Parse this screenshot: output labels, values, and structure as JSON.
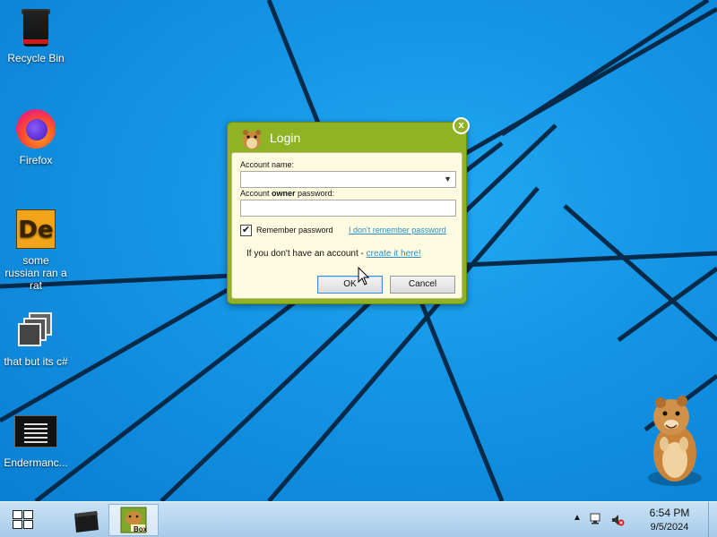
{
  "desktop": {
    "icons": [
      {
        "label": "Recycle Bin",
        "icon": "recycle-bin-icon"
      },
      {
        "label": "Firefox",
        "icon": "firefox-icon"
      },
      {
        "label": "some russian ran a rat",
        "icon": "de-app-icon"
      },
      {
        "label": "that but its c#",
        "icon": "stacked-windows-icon"
      },
      {
        "label": "Endermanc...",
        "icon": "console-icon"
      }
    ]
  },
  "dialog": {
    "title": "Login",
    "account_name_label": "Account name:",
    "account_name_value": "",
    "password_label_pre": "Account ",
    "password_label_bold": "owner",
    "password_label_post": " password:",
    "password_value": "",
    "remember_label": "Remember password",
    "remember_checked": "✔",
    "forgot_link": "I don't remember password",
    "no_account_text": "If you don't have an account - ",
    "create_link": "create it here!",
    "ok_label": "OK",
    "cancel_label": "Cancel",
    "close_label": "x"
  },
  "taskbar": {
    "apps": [
      {
        "name": "recycle-bin",
        "active": false
      },
      {
        "name": "sandbox-app",
        "active": true,
        "badge": "Box"
      }
    ],
    "tray": {
      "overflow_glyph": "▲",
      "time": "6:54 PM",
      "date": "9/5/2024"
    }
  },
  "colors": {
    "dialog_green": "#8fb325",
    "panel_bg": "#fffbe0",
    "link": "#2a8fc9",
    "desktop_blue": "#1596e6"
  }
}
